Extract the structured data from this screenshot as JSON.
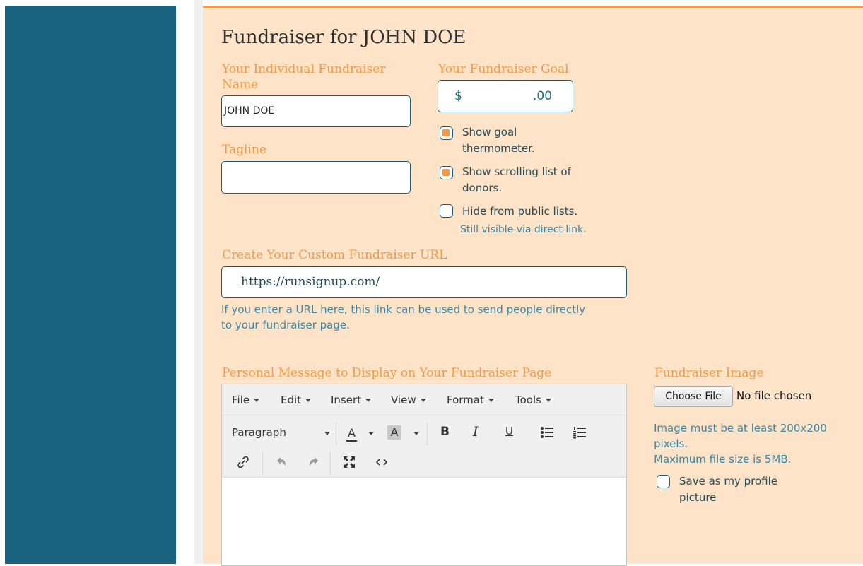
{
  "form": {
    "title": "Fundraiser for JOHN DOE",
    "name_label_line1": "Your Individual Fundraiser",
    "name_label_line2": "Name",
    "name_value": "JOHN DOE",
    "tagline_label": "Tagline",
    "tagline_value": "",
    "goal_label": "Your Fundraiser Goal",
    "goal_currency": "$",
    "goal_cents": ".00",
    "options": [
      {
        "line1": "Show goal",
        "line2": "thermometer.",
        "checked": true
      },
      {
        "line1": "Show scrolling list of",
        "line2": "donors.",
        "checked": true
      },
      {
        "line1": "Hide from public lists.",
        "line2": "",
        "checked": false
      }
    ],
    "hide_hint": "Still visible via direct link.",
    "url_label": "Create Your Custom Fundraiser URL",
    "url_prefix": "https://runsignup.com/",
    "url_hint_line1": "If you enter a URL here, this link can be used to send people directly",
    "url_hint_line2": "to your fundraiser page.",
    "message_label": "Personal Message to Display on Your Fundraiser Page",
    "image_label": "Fundraiser Image",
    "choose_file_label": "Choose File",
    "no_file_text": "No file chosen",
    "image_hint_line1": "Image must be at least 200x200",
    "image_hint_line2": "pixels.",
    "image_hint_line3": "Maximum file size is 5MB.",
    "profile_line1": "Save as my profile",
    "profile_line2": "picture",
    "profile_checked": false
  },
  "editor": {
    "menus": [
      "File",
      "Edit",
      "Insert",
      "View",
      "Format",
      "Tools"
    ],
    "block_format": "Paragraph",
    "font_color_glyph": "A",
    "bg_color_glyph": "A",
    "bold_glyph": "B",
    "italic_glyph": "I",
    "underline_glyph": "U",
    "content": ""
  },
  "colors": {
    "sidebar": "#196381",
    "panel": "#fde3c7",
    "accent": "#f29a49",
    "field_border": "#1f5a73",
    "hint_text": "#3d86a3"
  },
  "icons": [
    "link-icon",
    "undo-icon",
    "redo-icon",
    "fullscreen-icon",
    "code-icon",
    "bullet-list-icon",
    "numbered-list-icon"
  ]
}
